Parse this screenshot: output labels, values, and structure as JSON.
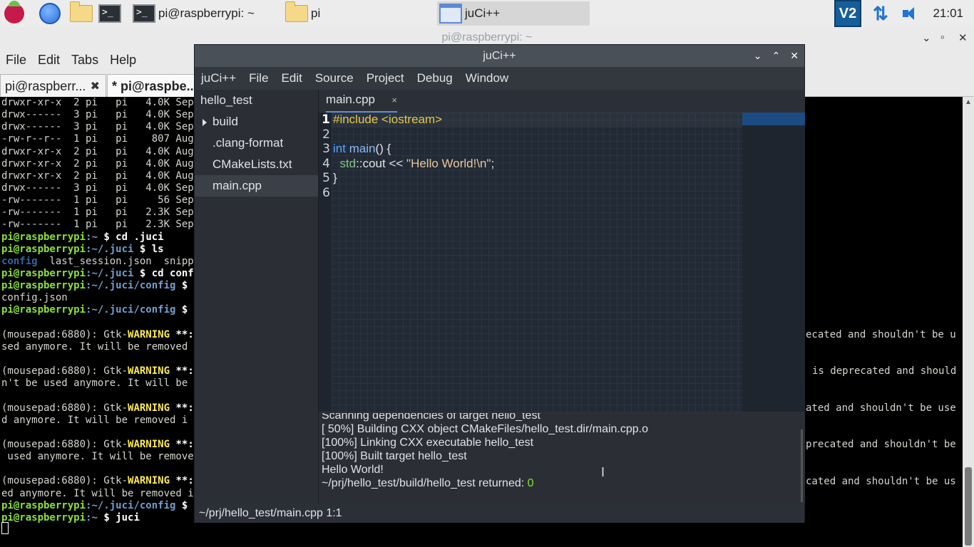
{
  "taskbar": {
    "tasks": [
      {
        "label": "pi@raspberrypi: ~"
      },
      {
        "label": "pi"
      },
      {
        "label": "juCi++"
      }
    ],
    "clock": "21:01",
    "vnc_label": "V2"
  },
  "bg_terminal": {
    "title": "pi@raspberrypi: ~",
    "menu": [
      "File",
      "Edit",
      "Tabs",
      "Help"
    ],
    "tabs": [
      {
        "label": "pi@raspberr...",
        "close": "✖"
      },
      {
        "label": "* pi@raspbe..."
      }
    ],
    "lines": [
      {
        "a": "drwxr-xr-x  2 pi   pi   4.0K Sep"
      },
      {
        "a": "drwx------  3 pi   pi   4.0K Sep"
      },
      {
        "a": "drwx------  3 pi   pi   4.0K Sep"
      },
      {
        "a": "-rw-r--r--  1 pi   pi    807 Aug"
      },
      {
        "a": "drwxr-xr-x  2 pi   pi   4.0K Aug"
      },
      {
        "a": "drwxr-xr-x  2 pi   pi   4.0K Aug"
      },
      {
        "a": "drwxr-xr-x  2 pi   pi   4.0K Aug"
      },
      {
        "a": "drwx------  3 pi   pi   4.0K Sep"
      },
      {
        "a": "-rw-------  1 pi   pi     56 Sep"
      },
      {
        "a": "-rw-------  1 pi   pi   2.3K Sep"
      },
      {
        "a": "-rw-------  1 pi   pi   2.3K Sep"
      }
    ],
    "prompt_user": "pi@raspberrypi",
    "p1_path": ":~ ",
    "p1_cmd": "$ cd .juci",
    "p2_path": ":~/.juci ",
    "p2_cmd": "$ ls",
    "ls_config": "config",
    "ls_rest": "  last_session.json  snipp",
    "p3_path": ":~/.juci ",
    "p3_cmd": "$ cd conf",
    "p4_path": ":~/.juci/config ",
    "p4_cmd": "$",
    "config_json": "config.json",
    "p5_path": ":~/.juci/config ",
    "p5_cmd": "$",
    "warn_prefix": "(mousepad:6880): Gtk-",
    "warn_word": "WARNING",
    "warn_suffix": " **:",
    "warn_second": [
      "sed anymore. It will be removed",
      "n't be used anymore. It will be",
      "d anymore. It will be removed i",
      " used anymore. It will be remove",
      "ed anymore. It will be removed i"
    ],
    "right_lines": [
      [
        "ecated and shouldn't be u"
      ],
      [
        "is deprecated and should"
      ],
      [
        "ated and shouldn't be use"
      ],
      [
        "precated and shouldn't be"
      ],
      [
        "cated and shouldn't be us"
      ]
    ],
    "p6_path": ":~/.juci/config ",
    "p6_cmd": "$",
    "p7_path": ":~ ",
    "p7_cmd": "$ juci"
  },
  "juci": {
    "title": "juCi++",
    "menu": [
      "juCi++",
      "File",
      "Edit",
      "Source",
      "Project",
      "Debug",
      "Window"
    ],
    "tree": {
      "root": "hello_test",
      "items": [
        "build",
        ".clang-format",
        "CMakeLists.txt",
        "main.cpp"
      ]
    },
    "tab": {
      "label": "main.cpp",
      "close": "×"
    },
    "line_numbers": [
      "1",
      "2",
      "3",
      "4",
      "5",
      "6"
    ],
    "code": {
      "l1_inc": "#include <iostream>",
      "l3_kw": "int",
      "l3_fn": " main",
      "l3_rest": "() {",
      "l4_indent": "  ",
      "l4_ns": "std",
      "l4_rest": "::cout << ",
      "l4_str": "\"Hello World!\\n\"",
      "l4_end": ";",
      "l5": "}"
    },
    "output": [
      "Scanning dependencies of target hello_test",
      "[ 50%] Building CXX object CMakeFiles/hello_test.dir/main.cpp.o",
      "[100%] Linking CXX executable hello_test",
      "[100%] Built target hello_test",
      "Hello World!"
    ],
    "returned_text": "~/prj/hello_test/build/hello_test returned: ",
    "returned_code": "0",
    "status": "~/prj/hello_test/main.cpp 1:1"
  }
}
